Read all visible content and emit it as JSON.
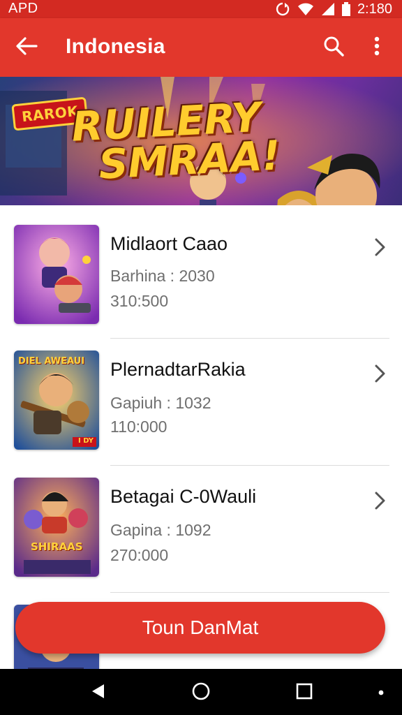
{
  "status_bar": {
    "carrier": "APD",
    "time": "2:180",
    "icons": [
      "sync-icon",
      "wifi-icon",
      "signal-icon",
      "battery-icon"
    ]
  },
  "app_bar": {
    "title": "Indonesia",
    "icons": [
      "back-arrow-icon",
      "search-icon",
      "more-vert-icon"
    ]
  },
  "banner": {
    "badge": "RAROK",
    "title_line1": "RUILERY",
    "title_line2": "SMRAA!"
  },
  "items": [
    {
      "title": "Midlaort Caao",
      "subtitle": "Barhina : 2030",
      "count": "310:500"
    },
    {
      "title": "PlernadtarRakia",
      "subtitle": "Gapiuh : 1032",
      "count": "110:000"
    },
    {
      "title": "Betagai C-0Wauli",
      "subtitle": "Gapina : 1092",
      "count": "270:000"
    },
    {
      "title": "",
      "subtitle": "",
      "count": ""
    }
  ],
  "thumbnail_labels": [
    "DIEL AWEAUI",
    "I DY",
    "SHIRAAS"
  ],
  "action_button": {
    "label": "Toun DanMat"
  },
  "nav_bar": {
    "icons": [
      "back-triangle-icon",
      "home-circle-icon",
      "recents-square-icon",
      "dot-icon"
    ]
  },
  "colors": {
    "primary": "#e2372c",
    "status": "#d32a22",
    "text": "#111111",
    "secondary_text": "#6f6f6f"
  }
}
